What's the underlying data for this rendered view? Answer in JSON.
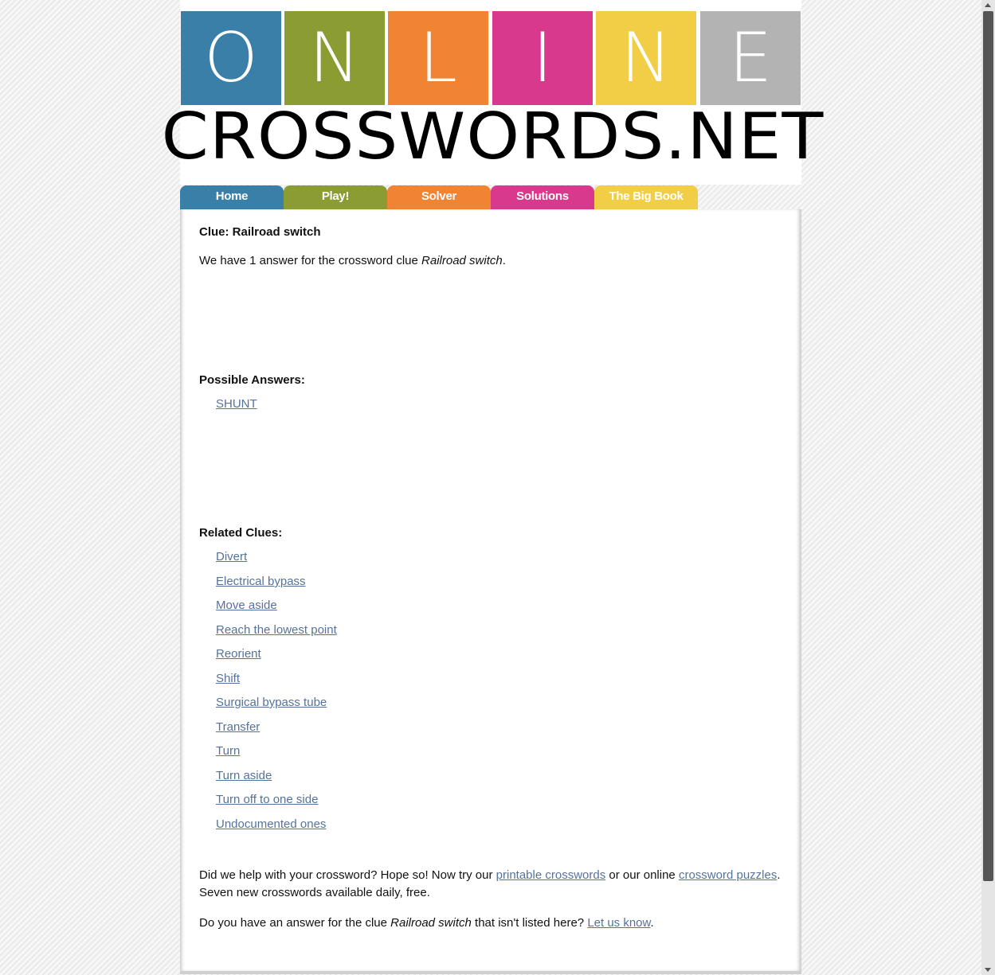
{
  "brand": {
    "letters": [
      {
        "char": "O",
        "color": "#3a7fa8"
      },
      {
        "char": "N",
        "color": "#8b9c33"
      },
      {
        "char": "L",
        "color": "#f08433"
      },
      {
        "char": "I",
        "color": "#d9398c"
      },
      {
        "char": "N",
        "color": "#f2ce46"
      },
      {
        "char": "E",
        "color": "#b3b3b3"
      }
    ],
    "wordmark": "CROSSWORDS.NET"
  },
  "nav": {
    "tabs": [
      {
        "label": "Home",
        "color": "#3a7fa8"
      },
      {
        "label": "Play!",
        "color": "#8b9c33"
      },
      {
        "label": "Solver",
        "color": "#f08433"
      },
      {
        "label": "Solutions",
        "color": "#d9398c"
      },
      {
        "label": "The Big Book",
        "color": "#f2ce46"
      }
    ]
  },
  "clue": {
    "heading": "Clue: Railroad switch",
    "intro_prefix": "We have 1 answer for the crossword clue ",
    "clue_text": "Railroad switch",
    "intro_suffix": "."
  },
  "answers": {
    "heading": "Possible Answers:",
    "items": [
      "SHUNT"
    ]
  },
  "related": {
    "heading": "Related Clues:",
    "items": [
      "Divert",
      "Electrical bypass",
      "Move aside",
      "Reach the lowest point",
      "Reorient",
      "Shift",
      "Surgical bypass tube",
      "Transfer",
      "Turn",
      "Turn aside",
      "Turn off to one side",
      "Undocumented ones"
    ]
  },
  "footer": {
    "help_prefix": "Did we help with your crossword? Hope so! Now try our ",
    "printable_link": "printable crosswords",
    "help_middle": " or our online ",
    "puzzles_link": "crossword puzzles",
    "help_suffix": ".",
    "help_line2": "Seven new crosswords available daily, free.",
    "ask_prefix": "Do you have an answer for the clue ",
    "ask_clue": "Railroad switch",
    "ask_middle": " that isn't listed here? ",
    "ask_link": "Let us know",
    "ask_suffix": "."
  }
}
